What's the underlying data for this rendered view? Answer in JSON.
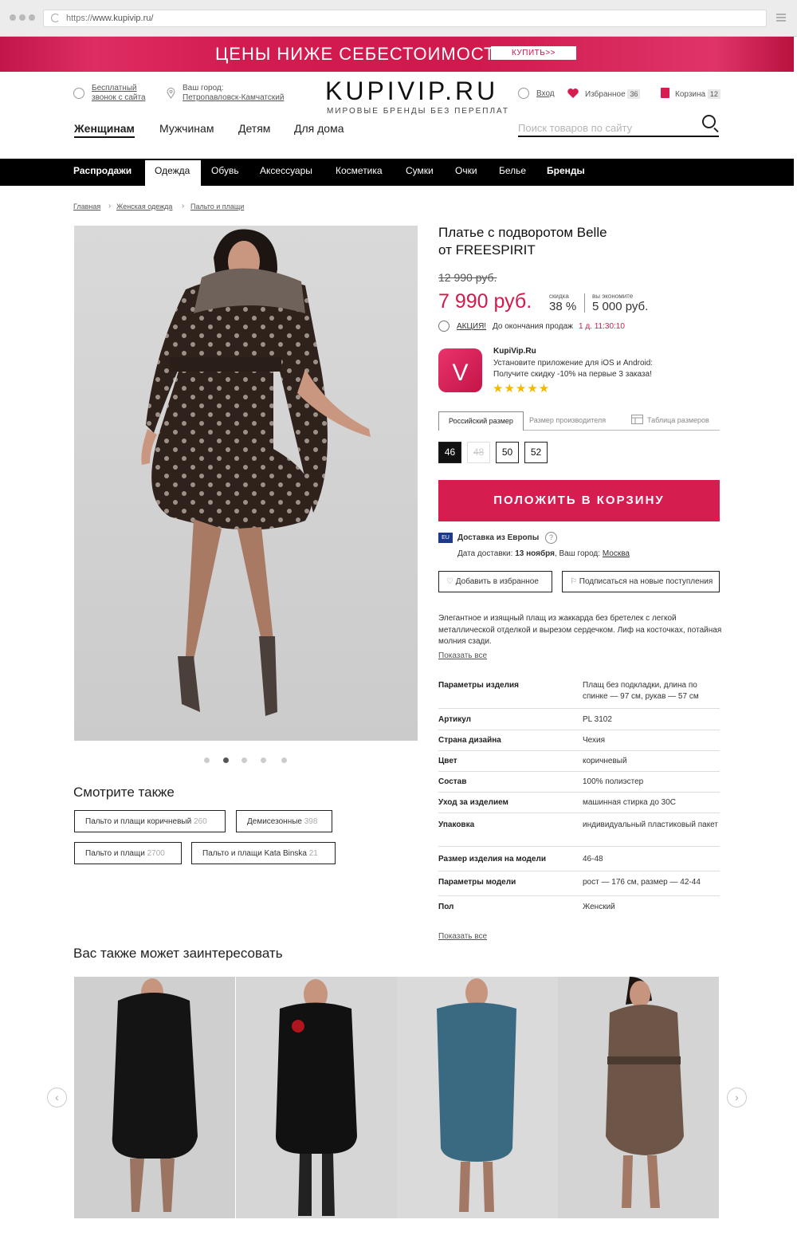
{
  "browser": {
    "url_scheme": "https://",
    "url_host": "www.kupivip.ru/"
  },
  "banner": {
    "title": "ЦЕНЫ НИЖЕ СЕБЕСТОИМОСТИ",
    "button": "КУПИТЬ>>"
  },
  "header": {
    "callback_line1": "Бесплатный",
    "callback_line2": "звонок с сайта",
    "city_label": "Ваш город:",
    "city_value": "Петропавловск-Камчатский",
    "logo": "KUPIVIP.RU",
    "tagline": "МИРОВЫЕ БРЕНДЫ БЕЗ ПЕРЕПЛАТ",
    "login": "Вход",
    "favorites": "Избранное",
    "favorites_count": "36",
    "cart": "Корзина",
    "cart_count": "12",
    "search_placeholder": "Поиск товаров по сайту",
    "nav": [
      "Женщинам",
      "Мужчинам",
      "Детям",
      "Для дома"
    ]
  },
  "categories": [
    "Распродажи",
    "Одежда",
    "Обувь",
    "Аксессуары",
    "Косметика",
    "Сумки",
    "Очки",
    "Белье",
    "Бренды"
  ],
  "breadcrumb": [
    "Главная",
    "Женская одежда",
    "Пальто и плащи"
  ],
  "product": {
    "title_line1": "Платье с подворотом Belle",
    "title_line2": "от FREESPIRIT",
    "old_price": "12 990 руб.",
    "price": "7 990 руб.",
    "discount_label": "скидка",
    "discount_value": "38 %",
    "save_label": "вы экономите",
    "save_value": "5 000 руб.",
    "promo_link": "АКЦИЯ!",
    "promo_text": "До окончания продаж",
    "promo_timer": "1 д. 11:30:10",
    "app_name": "KupiVip.Ru",
    "app_line1": "Установите приложение для iOS и Android:",
    "app_line2": "Получите скидку -10% на первые 3 заказа!",
    "stars": "★★★★★",
    "rating": 5,
    "size_tabs": [
      "Российский размер",
      "Размер производителя",
      "Таблица размеров"
    ],
    "sizes": [
      "46",
      "48",
      "50",
      "52"
    ],
    "add_to_cart": "ПОЛОЖИТЬ В КОРЗИНУ",
    "eu_badge": "EU",
    "delivery_title": "Доставка из Европы",
    "delivery_date_label": "Дата доставки:",
    "delivery_date": "13 ноября",
    "delivery_city_label": ", Ваш город:",
    "delivery_city": "Москва",
    "add_favorite": "Добавить в избранное",
    "subscribe": "Подписаться на новые поступления",
    "description": "Элегантное и изящный плащ из жаккарда без бретелек с легкой металлической отделкой и вырезом сердечком. Лиф на косточках, потайная молния сзади.",
    "show_all": "Показать все",
    "params": [
      {
        "k": "Параметры изделия",
        "v": "Плащ без подкладки, длина по спинке — 97 см, рукав — 57 см"
      },
      {
        "k": "Артикул",
        "v": "PL 3102"
      },
      {
        "k": "Страна дизайна",
        "v": "Чехия"
      },
      {
        "k": "Цвет",
        "v": "коричневый"
      },
      {
        "k": "Состав",
        "v": "100% полиэстер"
      },
      {
        "k": "Уход за изделием",
        "v": "машинная стирка до 30С"
      },
      {
        "k": "Упаковка",
        "v": "индивидуальный пластиковый пакет"
      },
      {
        "k": "Размер изделия на модели",
        "v": "46-48"
      },
      {
        "k": "Параметры модели",
        "v": "рост — 176 см, размер — 42-44"
      },
      {
        "k": "Пол",
        "v": "Женский"
      }
    ]
  },
  "see_also": {
    "title": "Смотрите также",
    "tags": [
      {
        "label": "Пальто и плащи коричневый",
        "count": "260"
      },
      {
        "label": "Демисезонные",
        "count": "398"
      },
      {
        "label": "Пальто и плащи",
        "count": "2700"
      },
      {
        "label": "Пальто и плащи Kata Binska",
        "count": "21"
      }
    ]
  },
  "recommend": {
    "title": "Вас также может заинтересовать"
  },
  "colors": {
    "accent": "#d61d50",
    "black": "#000000"
  }
}
